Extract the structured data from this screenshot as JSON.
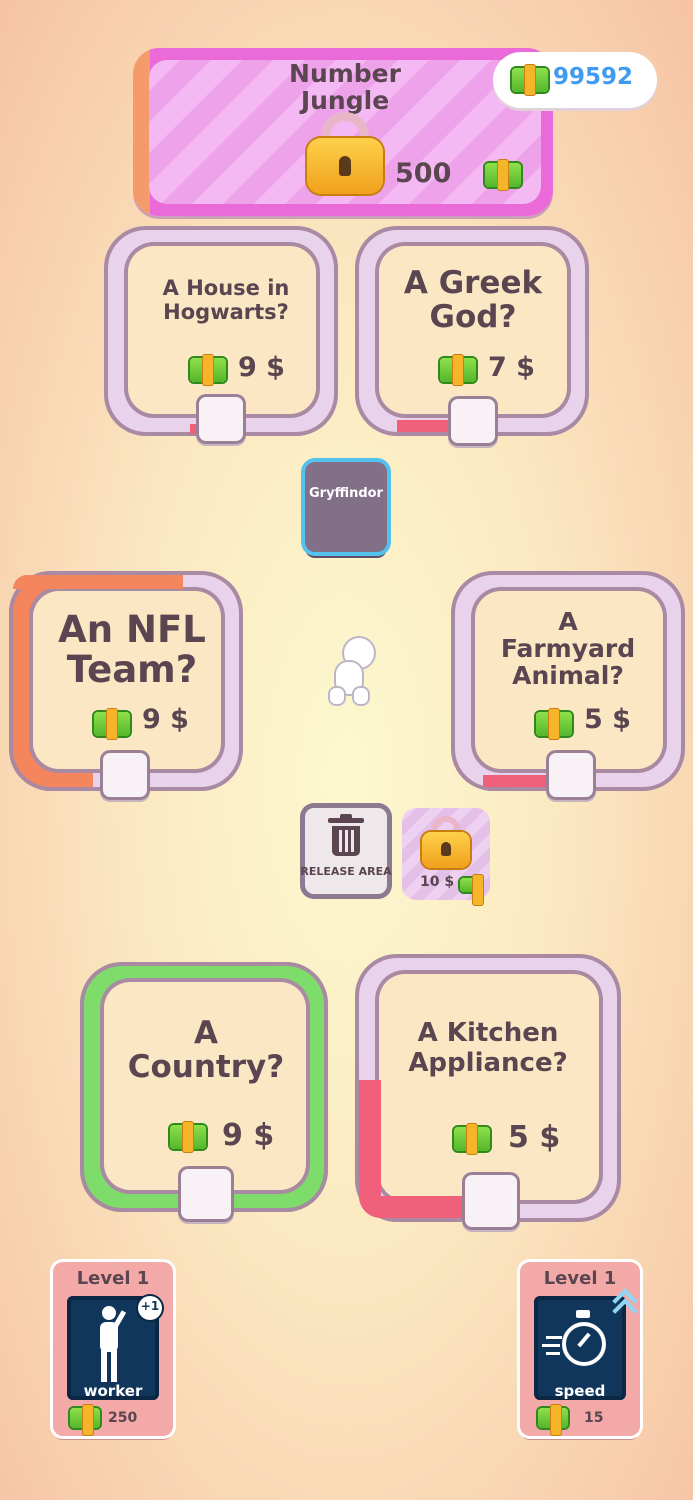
{
  "hud": {
    "coins": "99592"
  },
  "locked_area": {
    "title": "Number Jungle",
    "price": "500"
  },
  "stations": [
    {
      "question": "A House in Hogwarts?",
      "price": "9 $"
    },
    {
      "question": "A Greek God?",
      "price": "7 $"
    },
    {
      "question": "An NFL Team?",
      "price": "9 $"
    },
    {
      "question": "A Farmyard Animal?",
      "price": "5 $"
    },
    {
      "question": "A Country?",
      "price": "9 $"
    },
    {
      "question": "A Kitchen Appliance?",
      "price": "5 $"
    }
  ],
  "cube": {
    "label": "Gryffindor"
  },
  "release_area": {
    "label": "RELEASE AREA"
  },
  "unlock_slot": {
    "price": "10 $"
  },
  "upgrades": {
    "worker": {
      "level": "Level 1",
      "name": "worker",
      "cost": "250",
      "badge": "+1"
    },
    "speed": {
      "level": "Level 1",
      "name": "speed",
      "cost": "15"
    }
  },
  "colors": {
    "progress_orange": "#f5855c",
    "progress_green": "#7ddc6a",
    "progress_red": "#f0607a",
    "coin_blue": "#3f9bf0"
  },
  "icons": [
    "cash-icon",
    "lock-icon",
    "trash-icon",
    "worker-icon",
    "stopwatch-icon",
    "double-chevron-up-icon"
  ]
}
